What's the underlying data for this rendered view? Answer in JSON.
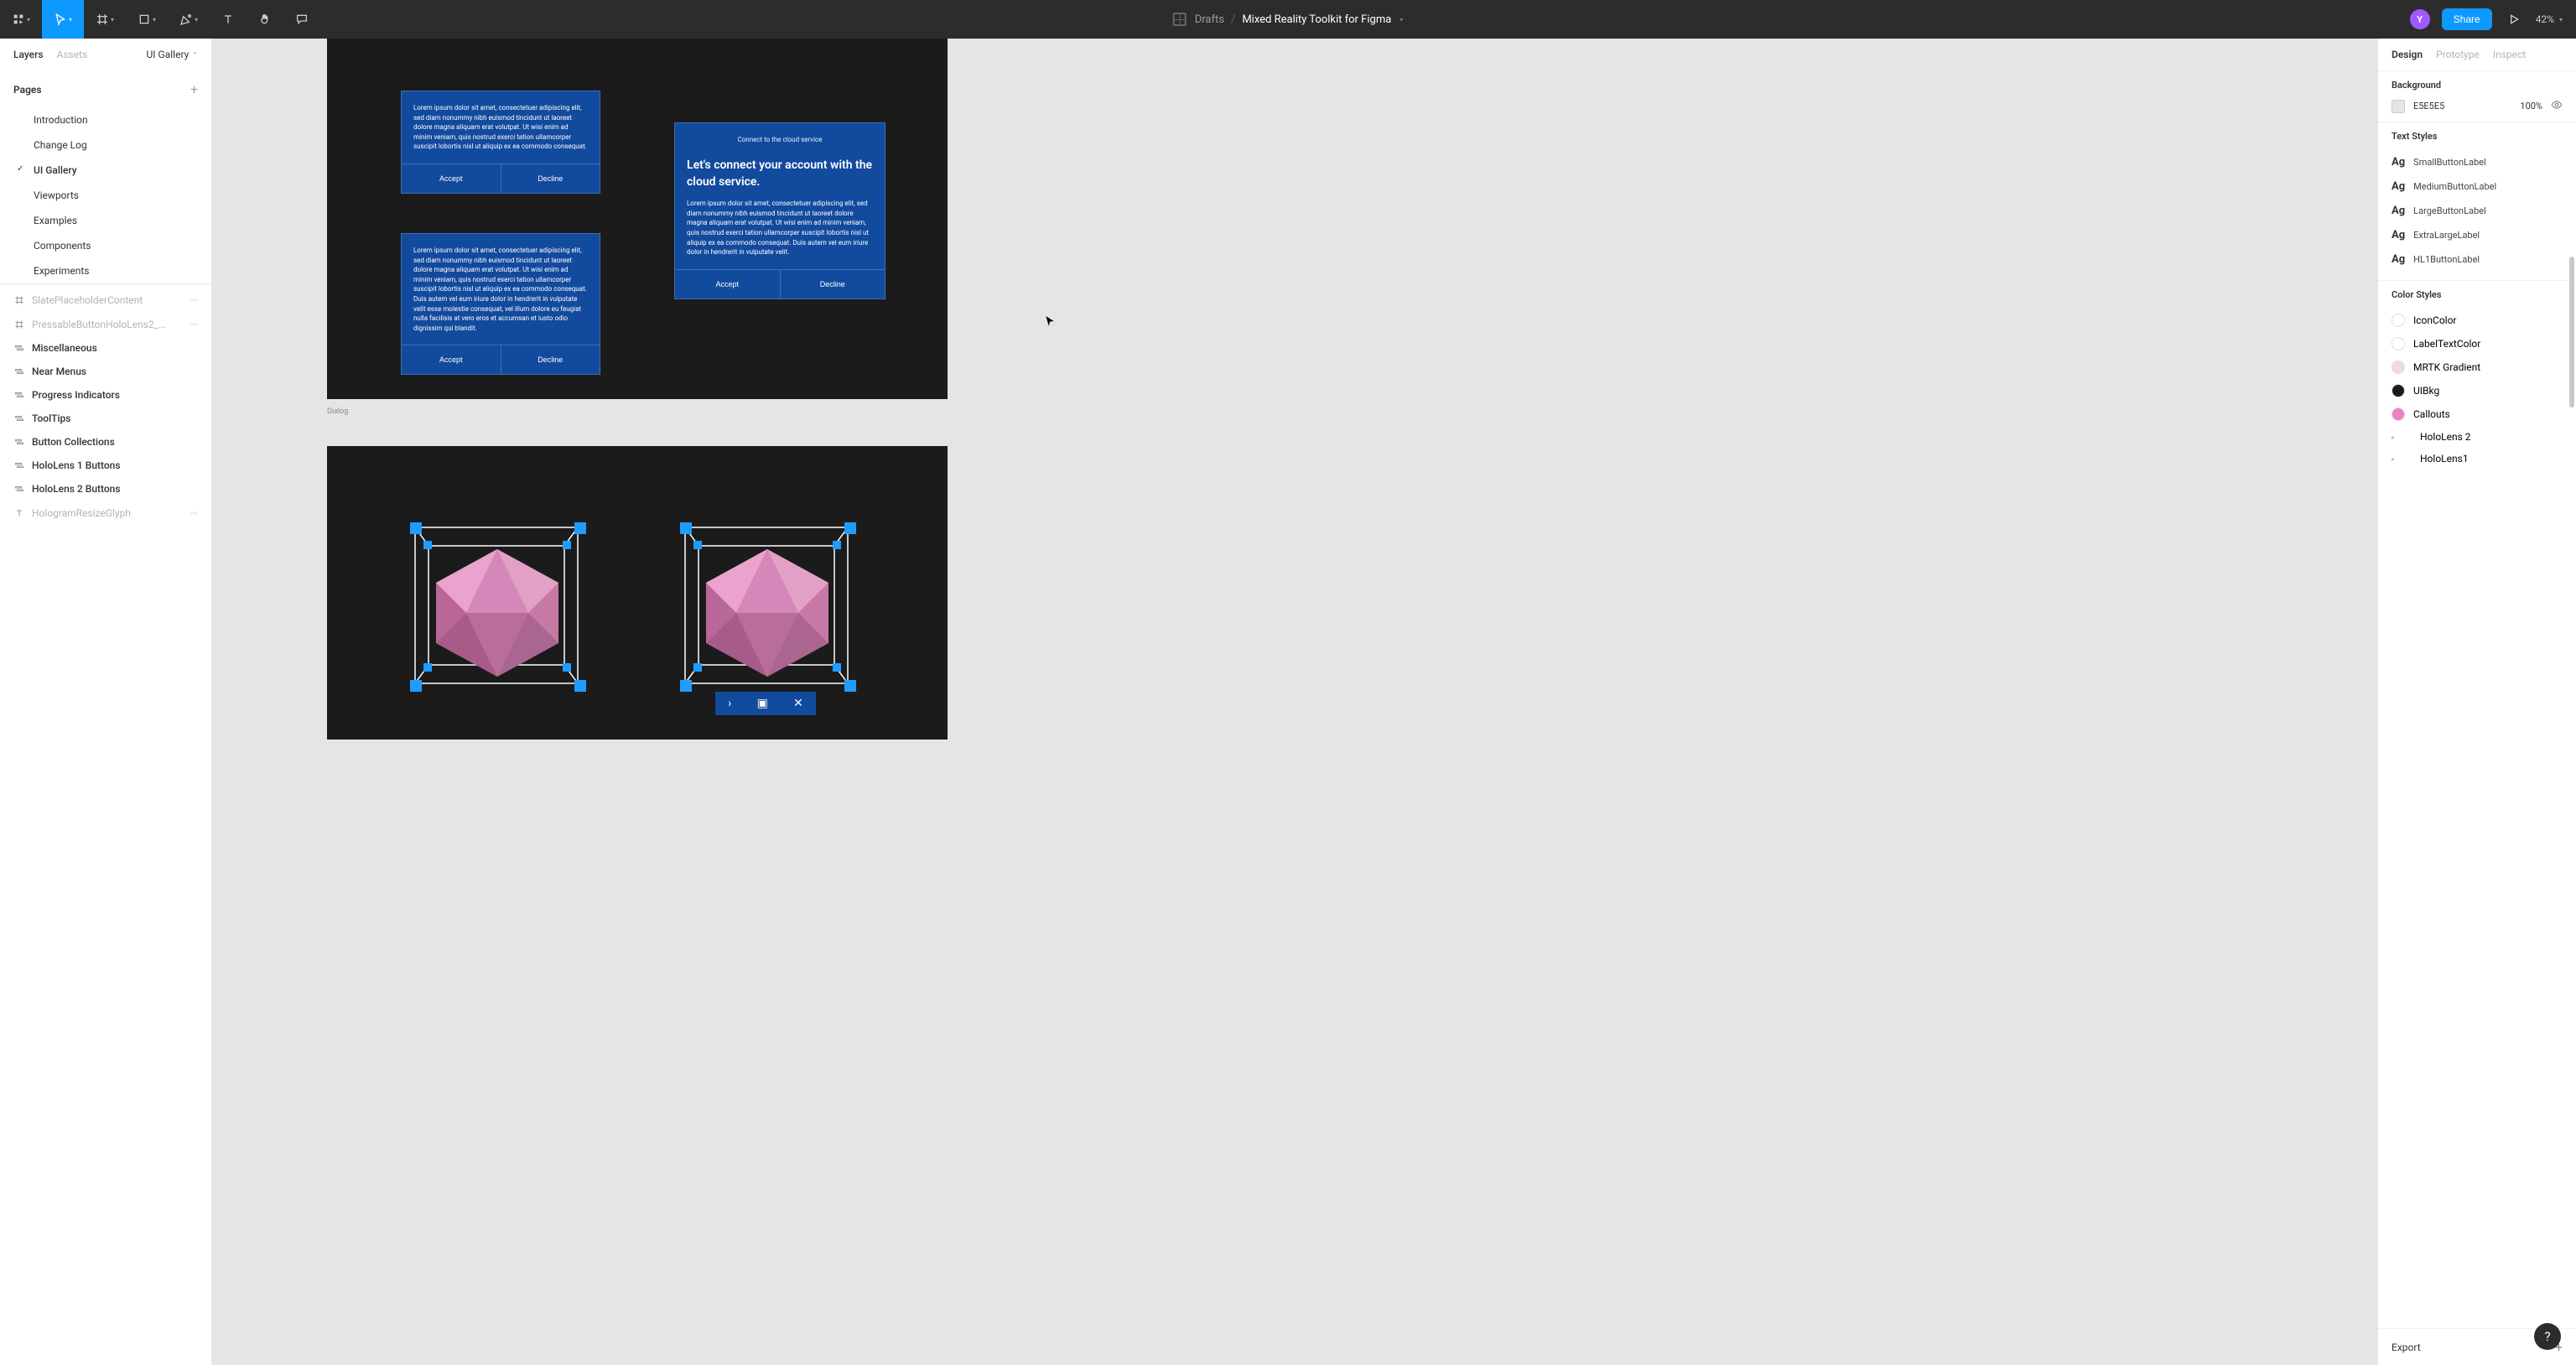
{
  "toolbar": {
    "drafts_label": "Drafts",
    "file_name": "Mixed Reality Toolkit for Figma",
    "avatar_initial": "Y",
    "share_label": "Share",
    "zoom": "42%"
  },
  "left_panel": {
    "tab_layers": "Layers",
    "tab_assets": "Assets",
    "current_page": "UI Gallery",
    "pages_header": "Pages",
    "pages": [
      {
        "label": "Introduction",
        "selected": false
      },
      {
        "label": "Change Log",
        "selected": false
      },
      {
        "label": "UI Gallery",
        "selected": true
      },
      {
        "label": "Viewports",
        "selected": false
      },
      {
        "label": "Examples",
        "selected": false
      },
      {
        "label": "Components",
        "selected": false
      },
      {
        "label": "Experiments",
        "selected": false
      }
    ],
    "layers": [
      {
        "icon": "frame",
        "label": "SlatePlaceholderContent",
        "dim": true,
        "wave": true
      },
      {
        "icon": "frame",
        "label": "PressableButtonHoloLens2_...",
        "dim": true,
        "wave": true
      },
      {
        "icon": "group",
        "label": "Miscellaneous",
        "bold": true
      },
      {
        "icon": "group",
        "label": "Near Menus",
        "bold": true
      },
      {
        "icon": "group",
        "label": "Progress Indicators",
        "bold": true
      },
      {
        "icon": "group",
        "label": "ToolTips",
        "bold": true
      },
      {
        "icon": "group",
        "label": "Button Collections",
        "bold": true
      },
      {
        "icon": "group",
        "label": "HoloLens 1 Buttons",
        "bold": true
      },
      {
        "icon": "group",
        "label": "HoloLens 2 Buttons",
        "bold": true
      },
      {
        "icon": "text",
        "label": "HologramResizeGlyph",
        "dim": true,
        "wave": true
      }
    ]
  },
  "canvas": {
    "frame_label": "Dialog",
    "dialog1": {
      "body": "Lorem ipsum dolor sit amet, consectetuer adipiscing elit, sed diam nonummy nibh euismod tincidunt ut laoreet dolore magna aliquam erat volutpat. Ut wisi enim ad minim veniam, quis nostrud exerci tation ullamcorper suscipit lobortis nisl ut aliquip ex ea commodo consequat.",
      "accept": "Accept",
      "decline": "Decline"
    },
    "dialog2": {
      "body": "Lorem ipsum dolor sit amet, consectetuer adipiscing elit, sed diam nonummy nibh euismod tincidunt ut laoreet dolore magna aliquam erat volutpat. Ut wisi enim ad minim veniam, quis nostrud exerci tation ullamcorper suscipit lobortis nisl ut aliquip ex ea commodo consequat. Duis autem vel eum iriure dolor in hendrerit in vulputate velit esse molestie consequat, vel illum dolore eu feugiat nulla facilisis at vero eros et accumsan et iusto odio dignissim qui blandit.",
      "accept": "Accept",
      "decline": "Decline"
    },
    "dialog3": {
      "subtitle": "Connect to the cloud service",
      "heading": "Let's connect your account with the cloud service.",
      "body": "Lorem ipsum dolor sit amet, consectetuer adipiscing elit, sed diam nonummy nibh euismod tincidunt ut laoreet dolore magna aliquam erat volutpat. Ut wisi enim ad minim veniam, quis nostrud exerci tation ullamcorper suscipit lobortis nisl ut aliquip ex ea commodo consequat. Duis autem vel eum iriure dolor in hendrerit in vulputate velit.",
      "accept": "Accept",
      "decline": "Decline"
    }
  },
  "right_panel": {
    "tab_design": "Design",
    "tab_prototype": "Prototype",
    "tab_inspect": "Inspect",
    "bg_header": "Background",
    "bg_hex": "E5E5E5",
    "bg_opacity": "100%",
    "text_styles_header": "Text Styles",
    "text_styles": [
      {
        "name": "SmallButtonLabel"
      },
      {
        "name": "MediumButtonLabel"
      },
      {
        "name": "LargeButtonLabel"
      },
      {
        "name": "ExtraLargeLabel"
      },
      {
        "name": "HL1ButtonLabel"
      }
    ],
    "color_styles_header": "Color Styles",
    "color_styles": [
      {
        "name": "IconColor",
        "hex": "#ffffff"
      },
      {
        "name": "LabelTextColor",
        "hex": "#ffffff"
      },
      {
        "name": "MRTK Gradient",
        "hex": "#f1d8e6"
      },
      {
        "name": "UIBkg",
        "hex": "#1b1b1b"
      },
      {
        "name": "Callouts",
        "hex": "#ef7fc8"
      }
    ],
    "color_groups": [
      {
        "name": "HoloLens 2"
      },
      {
        "name": "HoloLens1"
      }
    ],
    "export_label": "Export"
  }
}
